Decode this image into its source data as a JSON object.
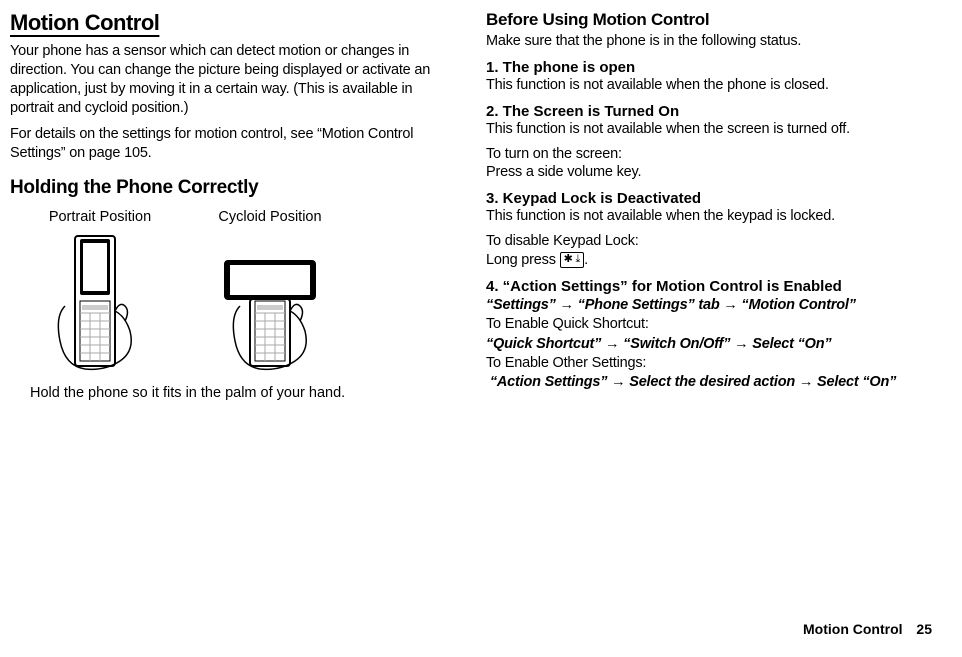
{
  "left": {
    "title": "Motion Control",
    "intro1": "Your phone has a sensor which can detect motion or changes in direction. You can change the picture being displayed or activate an application, just by moving it in a certain way. (This is available in portrait and cycloid position.)",
    "intro2": "For details on the settings for motion control, see “Motion Control Settings” on page 105.",
    "holding_title": "Holding the Phone Correctly",
    "fig1": "Portrait Position",
    "fig2": "Cycloid Position",
    "hold_caption": "Hold the phone so it fits in the palm of your hand."
  },
  "right": {
    "before_title": "Before Using Motion Control",
    "before_sub": "Make sure that the phone is in the following status.",
    "s1_title": "1. The phone is open",
    "s1_body": "This function is not available when the phone is closed.",
    "s2_title": "2. The Screen is Turned On",
    "s2_body1": "This function is not available when the screen is turned off.",
    "s2_body2": "To turn on the screen:",
    "s2_body3": "Press a side volume key.",
    "s3_title": "3. Keypad Lock is Deactivated",
    "s3_body1": "This function is not available when the keypad is locked.",
    "s3_body2": "To disable Keypad Lock:",
    "s3_body3a": "Long press ",
    "s3_key": "✱ ⤓",
    "s3_body3b": ".",
    "s4_title": "4. “Action Settings” for Motion Control is Enabled",
    "s4_nav1": "“Settings” → “Phone Settings” tab → “Motion Control”",
    "s4_body1": "To Enable Quick Shortcut:",
    "s4_nav2": "“Quick Shortcut” → “Switch On/Off” → Select “On”",
    "s4_body2": "To Enable Other Settings:",
    "s4_nav3": " “Action Settings” → Select the desired action → Select “On”"
  },
  "footer": {
    "section": "Motion Control",
    "page": "25"
  }
}
